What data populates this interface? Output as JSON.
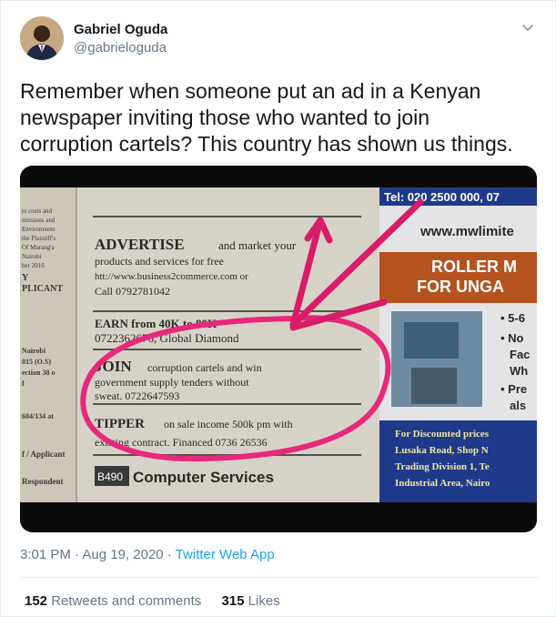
{
  "user": {
    "name": "Gabriel Oguda",
    "handle": "@gabrieloguda"
  },
  "tweet": {
    "text_line1": "Remember when someone put an ad in a Kenyan",
    "text_line2": "newspaper inviting those who wanted to join",
    "text_line3": "corruption cartels? This country has shown us things."
  },
  "clipping": {
    "left_col": [
      "to costs and",
      "missions and",
      "Environment",
      "the Plaintiff's",
      "Of Murang'a",
      "Nairobi",
      "ber 2016",
      "Y",
      "PLICANT",
      "Nairobi",
      "015 (O.S)",
      "ection 38 o",
      "f",
      "604/134 at",
      "f / Applicant",
      "Respondent"
    ],
    "advertise_head": "ADVERTISE",
    "advertise_body1": "and market your",
    "advertise_body2": "products and services for free",
    "advertise_body3": "htt://www.business2commerce.com or",
    "advertise_body4": "Call 0792781042",
    "earn_line1": "EARN from 40K to 80K",
    "earn_line2": "0722362676, Global Diamond",
    "join_head": "JOIN",
    "join_body1": "corruption cartels and win",
    "join_body2": "government supply tenders without",
    "join_body3": "sweat. 0722647593",
    "tipper_head": "TIPPER",
    "tipper_body1": "on sale income 500k pm with",
    "tipper_body2": "existing contract. Financed 0736 26536",
    "computer_tag": "B490",
    "computer_text": "Computer Services",
    "tel": "Tel: 020 2500 000, 07",
    "web": "www.mwlimite",
    "roller1": "ROLLER M",
    "roller2": "FOR UNGA",
    "bullets": [
      "• 5-6",
      "• No",
      "Fac",
      "Wh",
      "• Pre",
      "als"
    ],
    "discount1": "For Discounted prices",
    "discount2": "Lusaka Road, Shop N",
    "discount3": "Trading Division 1, Te",
    "discount4": "Industrial Area, Nairo"
  },
  "meta": {
    "time": "3:01 PM",
    "sep1": "·",
    "date": "Aug 19, 2020",
    "sep2": "·",
    "app": "Twitter Web App"
  },
  "stats": {
    "retweets_count": "152",
    "retweets_label": "Retweets and comments",
    "likes_count": "315",
    "likes_label": "Likes"
  },
  "colors": {
    "link": "#1da1f2",
    "secondary": "#657786",
    "circle": "#e8287a",
    "arrow": "#d81c68",
    "banner": "#1f3a8a"
  },
  "icons": {
    "chevron": "chevron-down-icon"
  }
}
